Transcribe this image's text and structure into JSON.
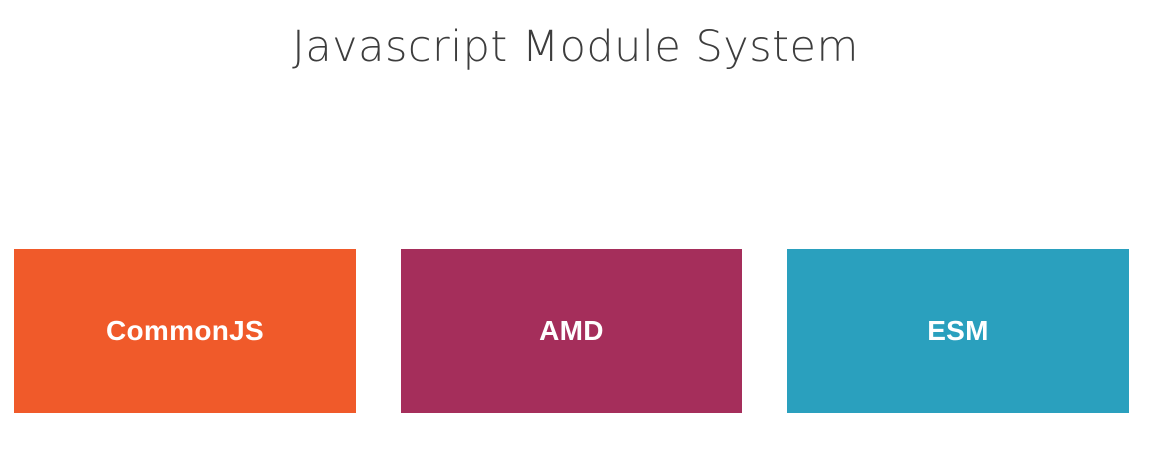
{
  "title": "Javascript Module System",
  "modules": [
    {
      "label": "CommonJS",
      "color": "#F05A2A"
    },
    {
      "label": "AMD",
      "color": "#A52E5B"
    },
    {
      "label": "ESM",
      "color": "#2AA0BE"
    }
  ]
}
